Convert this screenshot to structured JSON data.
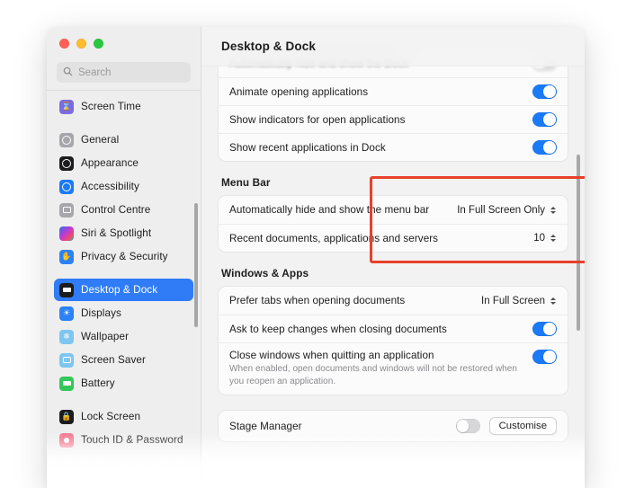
{
  "window": {
    "traffic_lights": [
      "close",
      "minimize",
      "maximize"
    ],
    "title": "Desktop & Dock"
  },
  "sidebar": {
    "search": {
      "placeholder": "Search",
      "value": "",
      "icon": "search-icon"
    },
    "items": [
      {
        "label": "Screen Time",
        "icon": "screen-time-icon",
        "selected": false,
        "gap_after": true
      },
      {
        "label": "General",
        "icon": "general-icon",
        "selected": false,
        "gap_after": false
      },
      {
        "label": "Appearance",
        "icon": "appearance-icon",
        "selected": false,
        "gap_after": false
      },
      {
        "label": "Accessibility",
        "icon": "accessibility-icon",
        "selected": false,
        "gap_after": false
      },
      {
        "label": "Control Centre",
        "icon": "control-centre-icon",
        "selected": false,
        "gap_after": false
      },
      {
        "label": "Siri & Spotlight",
        "icon": "siri-spotlight-icon",
        "selected": false,
        "gap_after": false
      },
      {
        "label": "Privacy & Security",
        "icon": "privacy-security-icon",
        "selected": false,
        "gap_after": true
      },
      {
        "label": "Desktop & Dock",
        "icon": "desktop-dock-icon",
        "selected": true,
        "gap_after": false
      },
      {
        "label": "Displays",
        "icon": "displays-icon",
        "selected": false,
        "gap_after": false
      },
      {
        "label": "Wallpaper",
        "icon": "wallpaper-icon",
        "selected": false,
        "gap_after": false
      },
      {
        "label": "Screen Saver",
        "icon": "screen-saver-icon",
        "selected": false,
        "gap_after": false
      },
      {
        "label": "Battery",
        "icon": "battery-icon",
        "selected": false,
        "gap_after": true
      },
      {
        "label": "Lock Screen",
        "icon": "lock-screen-icon",
        "selected": false,
        "gap_after": false
      },
      {
        "label": "Touch ID & Password",
        "icon": "touch-id-icon",
        "selected": false,
        "gap_after": false
      }
    ]
  },
  "main": {
    "title": "Desktop & Dock",
    "dock_group": {
      "rows": [
        {
          "label": "Automatically hide and show the Dock",
          "control": "toggle",
          "value": "off",
          "clipped": true
        },
        {
          "label": "Animate opening applications",
          "control": "toggle",
          "value": "on"
        },
        {
          "label": "Show indicators for open applications",
          "control": "toggle",
          "value": "on"
        },
        {
          "label": "Show recent applications in Dock",
          "control": "toggle",
          "value": "on"
        }
      ]
    },
    "menu_bar_section": {
      "title": "Menu Bar",
      "highlighted": true,
      "highlight_color": "#e8402a",
      "rows": [
        {
          "label": "Automatically hide and show the menu bar",
          "control": "popup",
          "value": "In Full Screen Only"
        },
        {
          "label": "Recent documents, applications and servers",
          "control": "stepper",
          "value": "10"
        }
      ]
    },
    "windows_apps_section": {
      "title": "Windows & Apps",
      "rows": [
        {
          "label": "Prefer tabs when opening documents",
          "control": "popup",
          "value": "In Full Screen",
          "sub": ""
        },
        {
          "label": "Ask to keep changes when closing documents",
          "control": "toggle",
          "value": "on",
          "sub": ""
        },
        {
          "label": "Close windows when quitting an application",
          "control": "toggle",
          "value": "on",
          "sub": "When enabled, open documents and windows will not be restored when you reopen an application."
        }
      ]
    },
    "stage_manager_section": {
      "rows": [
        {
          "label": "Stage Manager",
          "control": "toggle-and-button",
          "value": "off",
          "button_label": "Customise"
        }
      ]
    }
  }
}
